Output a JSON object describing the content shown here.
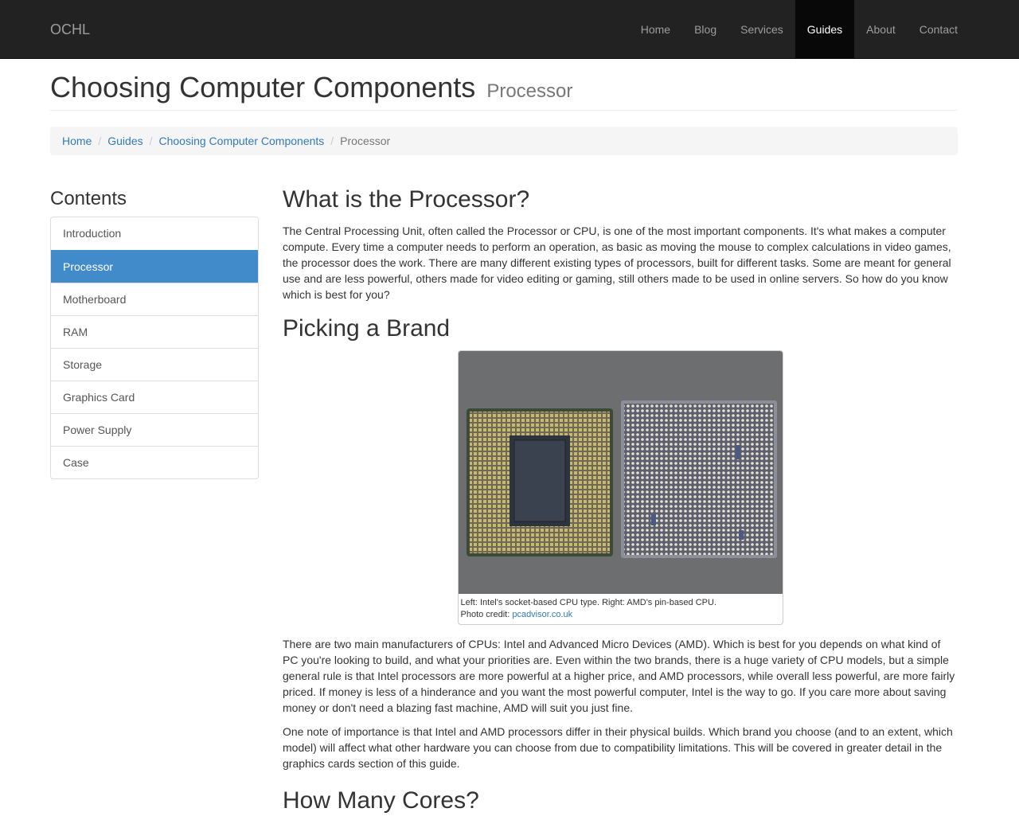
{
  "nav": {
    "brand": "OCHL",
    "items": [
      {
        "label": "Home"
      },
      {
        "label": "Blog"
      },
      {
        "label": "Services"
      },
      {
        "label": "Guides"
      },
      {
        "label": "About"
      },
      {
        "label": "Contact"
      }
    ],
    "active": "Guides"
  },
  "header": {
    "title": "Choosing Computer Components",
    "subtitle": "Processor"
  },
  "breadcrumb": {
    "items": [
      "Home",
      "Guides",
      "Choosing Computer Components"
    ],
    "current": "Processor"
  },
  "sidebar": {
    "heading": "Contents",
    "items": [
      "Introduction",
      "Processor",
      "Motherboard",
      "RAM",
      "Storage",
      "Graphics Card",
      "Power Supply",
      "Case"
    ],
    "active": "Processor"
  },
  "main": {
    "h_what": "What is the Processor?",
    "p_what": "The Central Processing Unit, often called the Processor or CPU, is one of the most important components. It's what makes a computer compute. Every time a computer needs to perform an operation, as basic as moving the mouse to complex calculations in video games, the processor does the work. There are many different existing types of processors, built for different tasks. Some are meant for general use and are less powerful, others made for video editing or gaming, still others made to be used in online servers. So how do you know which is best for you?",
    "h_brand": "Picking a Brand",
    "figure": {
      "caption_line1": "Left: Intel's socket-based CPU type. Right: AMD's pin-based CPU.",
      "credit_prefix": "Photo credit: ",
      "credit_link": "pcadvisor.co.uk"
    },
    "p_brand1": "There are two main manufacturers of CPUs: Intel and Advanced Micro Devices (AMD). Which is best for you depends on what kind of PC you're looking to build, and what your priorities are. Even within the two brands, there is a huge variety of CPU models, but a simple general rule is that Intel processors are more powerful at a higher price, and AMD processors, while overall less powerful, are more fairly priced. If money is less of a hinderance and you want the most powerful computer, Intel is the way to go. If you care more about saving money or don't need a blazing fast machine, AMD will suit you just fine.",
    "p_brand2": "One note of importance is that Intel and AMD processors differ in their physical builds. Which brand you choose (and to an extent, which model) will affect what other hardware you can choose from due to compatibility limitations. This will be covered in greater detail in the graphics cards section of this guide.",
    "h_cores": "How Many Cores?"
  },
  "colors": {
    "navbar_bg": "#222222",
    "link": "#337ab7",
    "active_list": "#428bca"
  }
}
